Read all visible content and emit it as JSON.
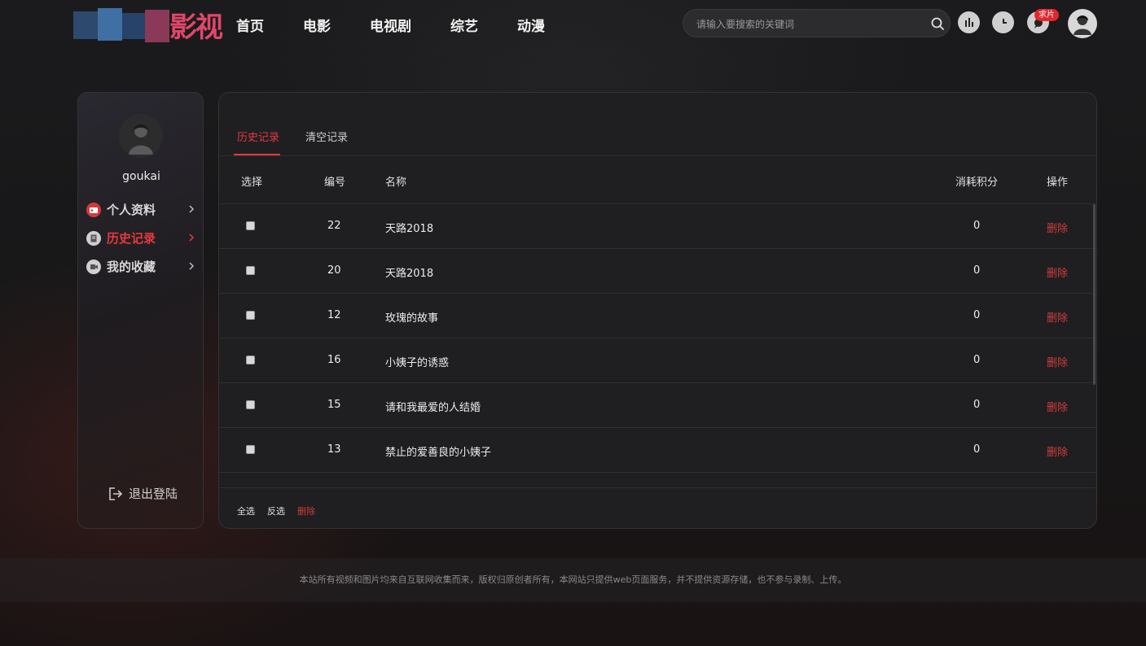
{
  "brand": {
    "logo_text": "影视",
    "accent_color": "#e5393f"
  },
  "nav": {
    "items": [
      "首页",
      "电影",
      "电视剧",
      "综艺",
      "动漫"
    ]
  },
  "search": {
    "placeholder": "请输入要搜索的关键词",
    "icon": "search-icon"
  },
  "header_actions": {
    "icons": [
      "chart-icon",
      "history-clock-icon",
      "chat-icon"
    ],
    "request_badge": "求片"
  },
  "sidebar": {
    "username": "goukai",
    "items": [
      {
        "label": "个人资料",
        "icon": "id-card-icon",
        "active": false
      },
      {
        "label": "历史记录",
        "icon": "document-icon",
        "active": true
      },
      {
        "label": "我的收藏",
        "icon": "video-icon",
        "active": false
      }
    ],
    "logout_label": "退出登陆"
  },
  "tabs": {
    "history": "历史记录",
    "clear": "清空记录"
  },
  "table": {
    "headers": {
      "select": "选择",
      "id": "编号",
      "name": "名称",
      "points": "消耗积分",
      "action": "操作"
    },
    "rows": [
      {
        "id": "22",
        "name": "天路2018",
        "points": "0",
        "action": "删除"
      },
      {
        "id": "20",
        "name": "天路2018",
        "points": "0",
        "action": "删除"
      },
      {
        "id": "12",
        "name": "玫瑰的故事",
        "points": "0",
        "action": "删除"
      },
      {
        "id": "16",
        "name": "小姨子的诱惑",
        "points": "0",
        "action": "删除"
      },
      {
        "id": "15",
        "name": "请和我最爱的人结婚",
        "points": "0",
        "action": "删除"
      },
      {
        "id": "13",
        "name": "禁止的爱善良的小姨子",
        "points": "0",
        "action": "删除"
      }
    ]
  },
  "bulk": {
    "select_all": "全选",
    "invert": "反选",
    "delete": "删除"
  },
  "footer": {
    "copyright": "本站所有视频和图片均来自互联网收集而来，版权归原创者所有，本网站只提供web页面服务，并不提供资源存储，也不参与录制、上传。"
  }
}
